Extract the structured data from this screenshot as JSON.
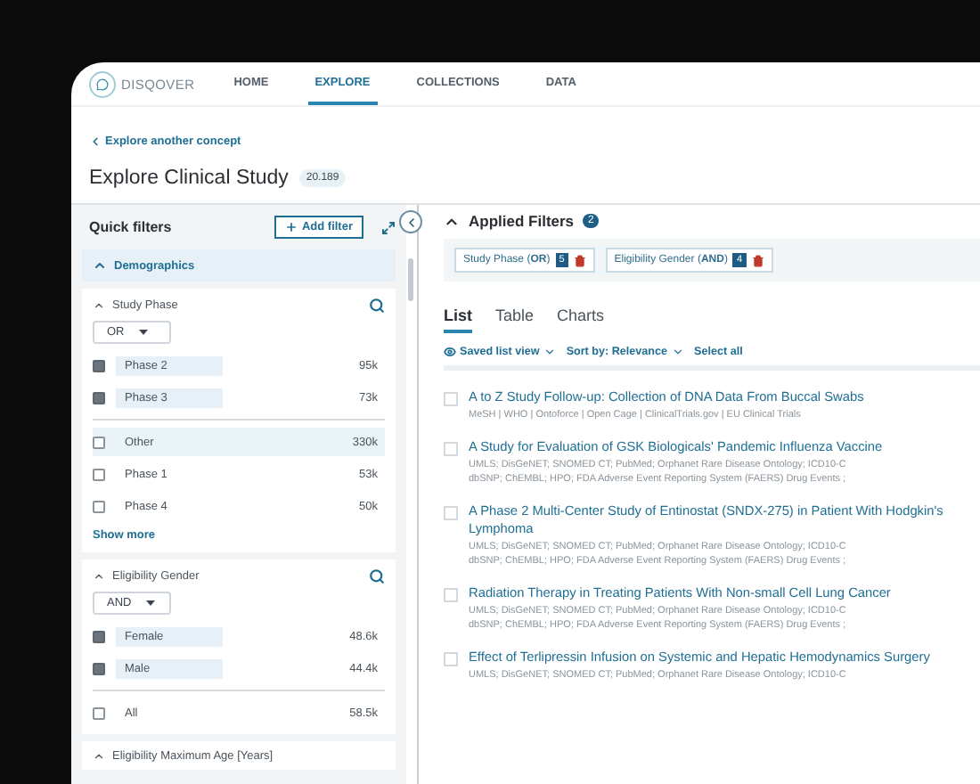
{
  "nav": {
    "logo": "DISQOVER",
    "items": [
      {
        "label": "HOME",
        "selected": false
      },
      {
        "label": "EXPLORE",
        "selected": true
      },
      {
        "label": "COLLECTIONS",
        "selected": false
      },
      {
        "label": "DATA",
        "selected": false
      }
    ]
  },
  "back_link": "Explore another concept",
  "page_title": "Explore Clinical Study",
  "count": "20.189",
  "quick_filters": {
    "title": "Quick filters",
    "add_button": "Add filter",
    "section": {
      "label": "Demographics",
      "expanded": true
    },
    "facets": [
      {
        "title": "Study Phase",
        "expanded": true,
        "operator": "OR",
        "groups": [
          [
            {
              "label": "Phase 2",
              "count": "95k",
              "checked": true,
              "hovered": false
            },
            {
              "label": "Phase 3",
              "count": "73k",
              "checked": true,
              "hovered": false
            }
          ],
          [
            {
              "label": "Other",
              "count": "330k",
              "checked": false,
              "hovered": true
            },
            {
              "label": "Phase 1",
              "count": "53k",
              "checked": false,
              "hovered": false
            },
            {
              "label": "Phase 4",
              "count": "50k",
              "checked": false,
              "hovered": false
            }
          ]
        ],
        "show_more": "Show more"
      },
      {
        "title": "Eligibility Gender",
        "expanded": true,
        "operator": "AND",
        "groups": [
          [
            {
              "label": "Female",
              "count": "48.6k",
              "checked": true,
              "hovered": false
            },
            {
              "label": "Male",
              "count": "44.4k",
              "checked": true,
              "hovered": false
            }
          ],
          [
            {
              "label": "All",
              "count": "58.5k",
              "checked": false,
              "hovered": false
            }
          ]
        ]
      },
      {
        "title": "Eligibility Maximum Age [Years]",
        "expanded": true
      }
    ]
  },
  "applied_filters": {
    "title": "Applied Filters",
    "count": "2",
    "expanded": true,
    "chips": [
      {
        "label": "Study Phase (**OR**)",
        "count": "5"
      },
      {
        "label": "Eligibility Gender (**AND**)",
        "count": "4"
      }
    ]
  },
  "tabs": [
    {
      "label": "List",
      "selected": true
    },
    {
      "label": "Table",
      "selected": false
    },
    {
      "label": "Charts",
      "selected": false
    }
  ],
  "toolbar": {
    "saved_view": "Saved list view",
    "sort": "Sort by: Relevance",
    "select_all": "Select all"
  },
  "results": [
    {
      "title": "A to Z Study Follow-up: Collection of DNA Data From Buccal Swabs",
      "checked": false,
      "sources": [
        "MeSH | WHO | Ontoforce | Open Cage | ClinicalTrials.gov | EU Clinical Trials"
      ]
    },
    {
      "title": "A Study for Evaluation of GSK Biologicals' Pandemic Influenza Vaccine",
      "checked": false,
      "sources": [
        "UMLS; DisGeNET; SNOMED CT; PubMed; Orphanet Rare Disease Ontology; ICD10-C",
        "dbSNP; ChEMBL; HPO; FDA Adverse Event Reporting System (FAERS) Drug Events ;"
      ]
    },
    {
      "title": "A Phase 2 Multi-Center Study of Entinostat (SNDX-275) in Patient With Hodgkin's Lymphoma",
      "checked": false,
      "sources": [
        "UMLS; DisGeNET; SNOMED CT; PubMed; Orphanet Rare Disease Ontology; ICD10-C",
        "dbSNP; ChEMBL; HPO; FDA Adverse Event Reporting System (FAERS) Drug Events ;"
      ]
    },
    {
      "title": "Radiation Therapy in Treating Patients With Non-small Cell Lung Cancer",
      "checked": false,
      "sources": [
        "UMLS; DisGeNET; SNOMED CT; PubMed; Orphanet Rare Disease Ontology; ICD10-C",
        "dbSNP; ChEMBL; HPO; FDA Adverse Event Reporting System (FAERS) Drug Events ;"
      ]
    },
    {
      "title": "Effect of Terlipressin Infusion on Systemic and Hepatic Hemodynamics Surgery",
      "checked": false,
      "sources": [
        "UMLS; DisGeNET; SNOMED CT; PubMed; Orphanet Rare Disease Ontology; ICD10-C"
      ]
    }
  ]
}
